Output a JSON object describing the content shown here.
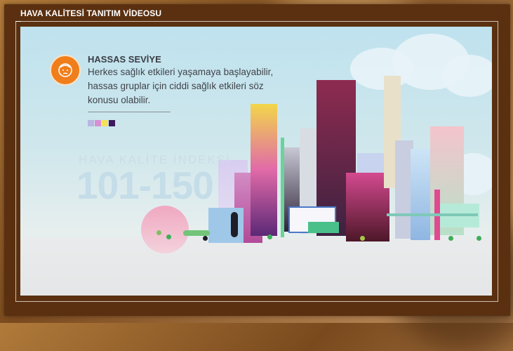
{
  "window": {
    "title": "HAVA KALİTESİ TANITIM VİDEOSU"
  },
  "info": {
    "icon": "face-icon",
    "level_title": "HASSAS SEVİYE",
    "description": "Herkes sağlık etkileri yaşamaya başlayabilir, hassas gruplar için ciddi sağlık etkileri söz konusu olabilir."
  },
  "index": {
    "label": "HAVA KALİTE İNDEKSİ",
    "range": "101-150"
  },
  "colors": {
    "accent": "#f07e1a",
    "swatches": [
      "#b9b6e3",
      "#d88fd3",
      "#f2e15a",
      "#3c1a5e"
    ]
  }
}
